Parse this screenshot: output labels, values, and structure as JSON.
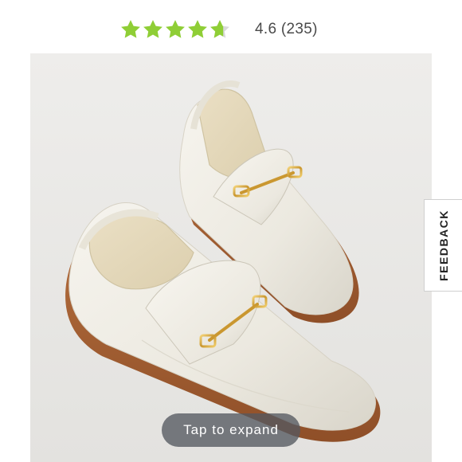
{
  "rating": {
    "value": "4.6",
    "count": "(235)",
    "stars_filled": 4.6,
    "star_color": "#8fce36"
  },
  "product_image": {
    "description_icon": "loafer-shoes-image",
    "background_color": "#ecebe8"
  },
  "feedback": {
    "label": "FEEDBACK"
  },
  "expand": {
    "label": "Tap to expand"
  }
}
